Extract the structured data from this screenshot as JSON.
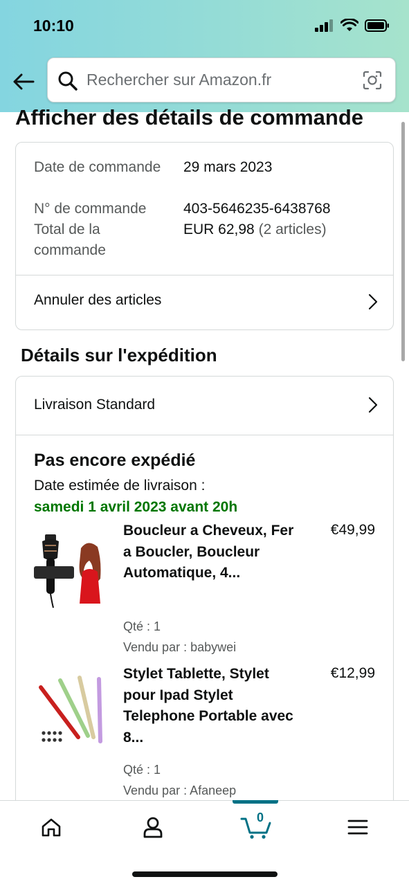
{
  "status_bar": {
    "time": "10:10"
  },
  "search": {
    "placeholder": "Rechercher sur Amazon.fr"
  },
  "page": {
    "title": "Afficher des détails de commande"
  },
  "order": {
    "date_label": "Date de commande",
    "date_value": "29 mars 2023",
    "number_label": "N° de commande",
    "number_value": "403-5646235-6438768",
    "total_label": "Total de la commande",
    "total_value": "EUR 62,98",
    "total_count": "(2 articles)",
    "cancel_label": "Annuler des articles"
  },
  "shipping": {
    "section_title": "Détails sur l'expédition",
    "method_label": "Livraison Standard",
    "status": "Pas encore expédié",
    "eta_label": "Date estimée de livraison :",
    "eta_date": "samedi 1 avril 2023 avant 20h",
    "items": [
      {
        "title": "Boucleur a Cheveux, Fer a Boucler, Boucleur Automatique, 4...",
        "price": "€49,99",
        "qty": "Qté : 1",
        "seller": "Vendu par : babywei"
      },
      {
        "title": "Stylet Tablette, Stylet pour Ipad Stylet Telephone Portable avec 8...",
        "price": "€12,99",
        "qty": "Qté : 1",
        "seller": "Vendu par : Afaneep"
      }
    ]
  },
  "nav": {
    "cart_count": "0"
  },
  "colors": {
    "accent": "#007185",
    "eta_green": "#007600",
    "header_gradient_start": "#84d5e0",
    "header_gradient_end": "#a6e3cc"
  },
  "icons": [
    "back-arrow-icon",
    "search-icon",
    "camera-icon",
    "chevron-right-icon",
    "home-icon",
    "account-icon",
    "cart-icon",
    "menu-icon"
  ]
}
